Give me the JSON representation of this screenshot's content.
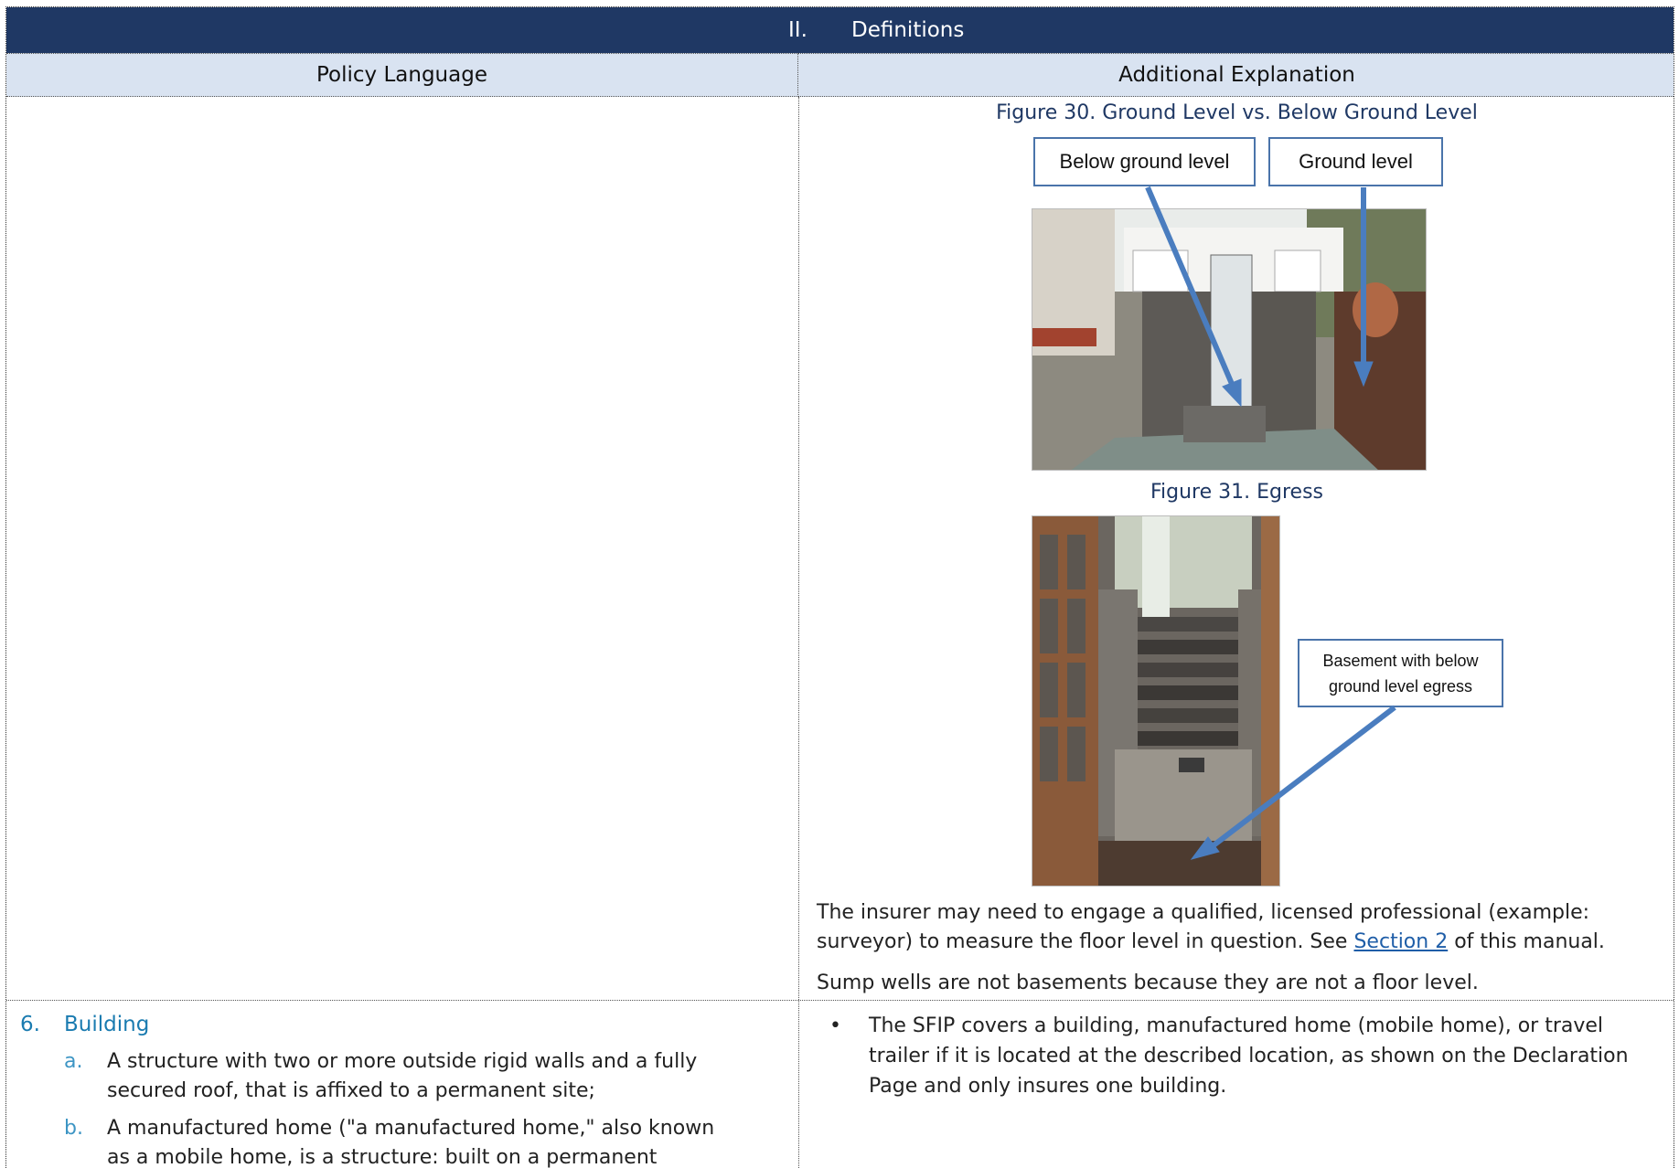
{
  "banner": {
    "section_number": "II.",
    "section_title": "Definitions"
  },
  "columns": {
    "left": "Policy Language",
    "right": "Additional Explanation"
  },
  "figure30": {
    "caption": "Figure 30. Ground Level vs. Below Ground Level",
    "callout_below": "Below ground level",
    "callout_ground": "Ground level"
  },
  "figure31": {
    "caption": "Figure 31. Egress",
    "callout_line1": "Basement with below",
    "callout_line2": "ground level egress"
  },
  "explanation": {
    "para1_before": "The insurer may need to engage a qualified, licensed professional (example: surveyor) to measure the floor level in question. See ",
    "para1_link": "Section 2",
    "para1_after": " of this manual.",
    "para2": "Sump wells are not basements because they are not a floor level."
  },
  "definition": {
    "number": "6.",
    "title": "Building",
    "items": [
      {
        "letter": "a.",
        "text": "A structure with two or more outside rigid walls and a fully secured roof, that is affixed to a permanent site;"
      },
      {
        "letter": "b.",
        "text": "A manufactured home (\"a manufactured home,\" also known as a mobile home, is a structure: built on a permanent chassis,"
      }
    ]
  },
  "bullets": [
    "The SFIP covers a building, manufactured home (mobile home), or travel trailer if it is located at the described location, as shown on the Declaration Page and only insures one building."
  ],
  "colors": {
    "banner": "#1f3864",
    "header": "#d9e3f1",
    "accent": "#1a7bb0",
    "callout_border": "#4a74aa"
  }
}
